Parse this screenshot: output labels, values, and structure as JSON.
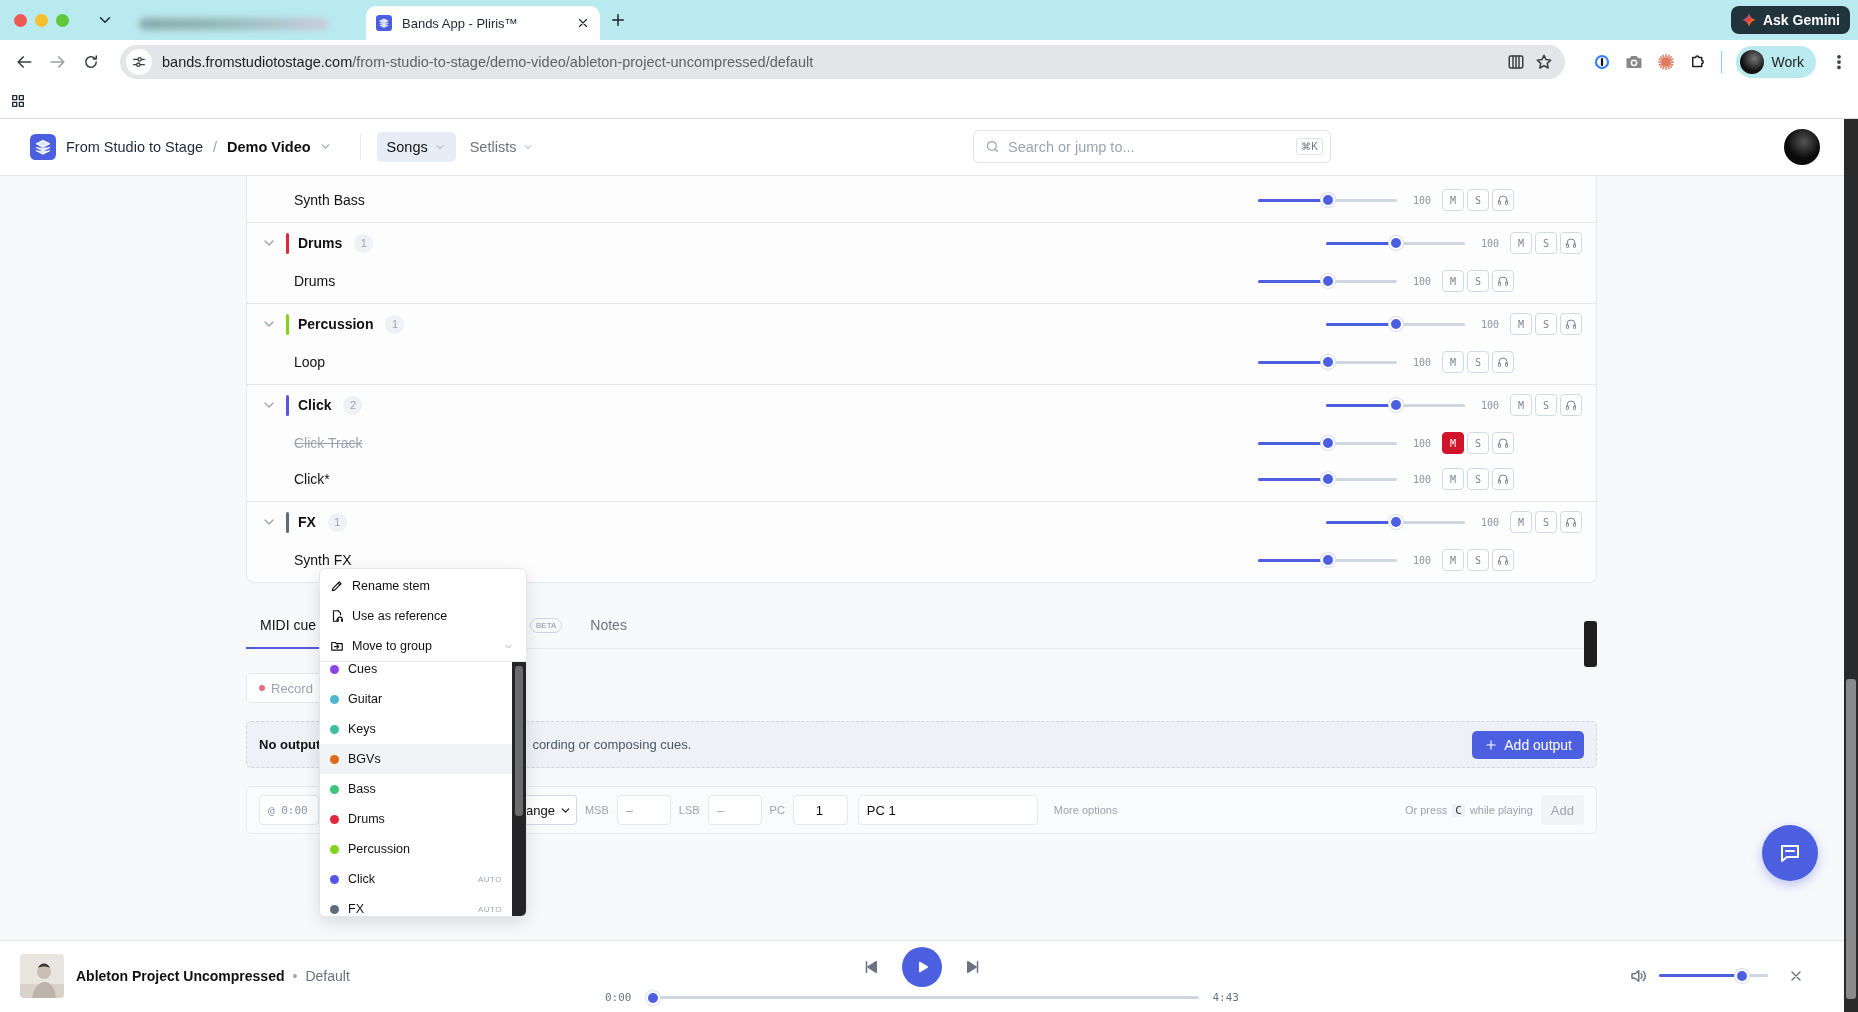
{
  "browser": {
    "active_tab": {
      "title": "Bands App - Pliris™"
    },
    "ask_button": "Ask Gemini",
    "url_host": "bands.fromstudiotostage.com",
    "url_path": "/from-studio-to-stage/demo-video/ableton-project-uncompressed/default",
    "profile": "Work"
  },
  "header": {
    "workspace": "From Studio to Stage",
    "separator": "/",
    "project": "Demo Video",
    "nav": [
      {
        "label": "Songs",
        "selected": true
      },
      {
        "label": "Setlists",
        "selected": false
      }
    ],
    "search": {
      "placeholder": "Search or jump to...",
      "shortcut": "⌘K"
    }
  },
  "groups": [
    {
      "stems": [
        {
          "name": "Synth Bass",
          "level": 0.5,
          "reading": "100",
          "mute_key": "M",
          "solo_key": "S",
          "muted": false
        }
      ]
    },
    {
      "name": "Drums",
      "color": "#e0283c",
      "count": "1",
      "expanded": true,
      "level": 0.5,
      "reading": "100",
      "mute_key": "M",
      "solo_key": "S",
      "muted": false,
      "stems": [
        {
          "name": "Drums",
          "level": 0.5,
          "reading": "100",
          "mute_key": "M",
          "solo_key": "S",
          "muted": false
        }
      ]
    },
    {
      "name": "Percussion",
      "color": "#84d21c",
      "count": "1",
      "expanded": true,
      "level": 0.5,
      "reading": "100",
      "mute_key": "M",
      "solo_key": "S",
      "muted": false,
      "stems": [
        {
          "name": "Loop",
          "level": 0.5,
          "reading": "100",
          "mute_key": "M",
          "solo_key": "S",
          "muted": false
        }
      ]
    },
    {
      "name": "Click",
      "color": "#5a55e6",
      "count": "2",
      "expanded": true,
      "level": 0.5,
      "reading": "100",
      "mute_key": "M",
      "solo_key": "S",
      "muted": false,
      "stems": [
        {
          "name": "Click Track",
          "level": 0.5,
          "reading": "100",
          "mute_key": "M",
          "solo_key": "S",
          "muted": true
        },
        {
          "name": "Click*",
          "level": 0.5,
          "reading": "100",
          "mute_key": "M",
          "solo_key": "S",
          "muted": false
        }
      ]
    },
    {
      "name": "FX",
      "color": "#5f6b7a",
      "count": "1",
      "expanded": true,
      "level": 0.5,
      "reading": "100",
      "mute_key": "M",
      "solo_key": "S",
      "muted": false,
      "stems": [
        {
          "name": "Synth FX",
          "level": 0.5,
          "reading": "100",
          "mute_key": "M",
          "solo_key": "S",
          "muted": false
        }
      ]
    }
  ],
  "cues": {
    "tabs": [
      {
        "label": "MIDI cue",
        "selected": true
      },
      {
        "badge": "BETA",
        "selected": false
      },
      {
        "label": "Notes",
        "selected": false
      }
    ],
    "record": "Record",
    "notice": {
      "title": "No output",
      "text": "cording or composing cues.",
      "button": "Add output"
    },
    "input_row": {
      "time": "@ 0:00",
      "select": "ange",
      "fields": [
        {
          "label": "MSB",
          "placeholder": "–"
        },
        {
          "label": "LSB",
          "placeholder": "–"
        },
        {
          "label": "PC",
          "value": "1"
        }
      ],
      "name_value": "PC 1",
      "more": "More options",
      "hint_before": "Or press",
      "hint_key": "C",
      "hint_after": "while playing",
      "add": "Add"
    }
  },
  "menu": {
    "actions": [
      {
        "kind": "rename",
        "label": "Rename stem"
      },
      {
        "kind": "reference",
        "label": "Use as reference"
      },
      {
        "kind": "move",
        "label": "Move to group"
      }
    ],
    "groups": [
      {
        "name": "Cues",
        "color": "#8b45e8",
        "highlighted": false
      },
      {
        "name": "Guitar",
        "color": "#4fb8cc",
        "highlighted": false
      },
      {
        "name": "Keys",
        "color": "#3dbfa0",
        "highlighted": false
      },
      {
        "name": "BGVs",
        "color": "#e06a1c",
        "highlighted": true
      },
      {
        "name": "Bass",
        "color": "#3cc47a",
        "highlighted": false
      },
      {
        "name": "Drums",
        "color": "#e0283c",
        "highlighted": false
      },
      {
        "name": "Percussion",
        "color": "#84d21c",
        "highlighted": false
      },
      {
        "name": "Click",
        "color": "#5a55e6",
        "tag": "AUTO",
        "highlighted": false
      },
      {
        "name": "FX",
        "color": "#5f6b7a",
        "tag": "AUTO",
        "highlighted": false
      }
    ]
  },
  "player": {
    "title": "Ableton Project Uncompressed",
    "separator": "•",
    "version": "Default",
    "elapsed": "0:00",
    "duration": "4:43",
    "progress": {
      "level": 0
    },
    "volume": {
      "level": 0.8
    }
  }
}
